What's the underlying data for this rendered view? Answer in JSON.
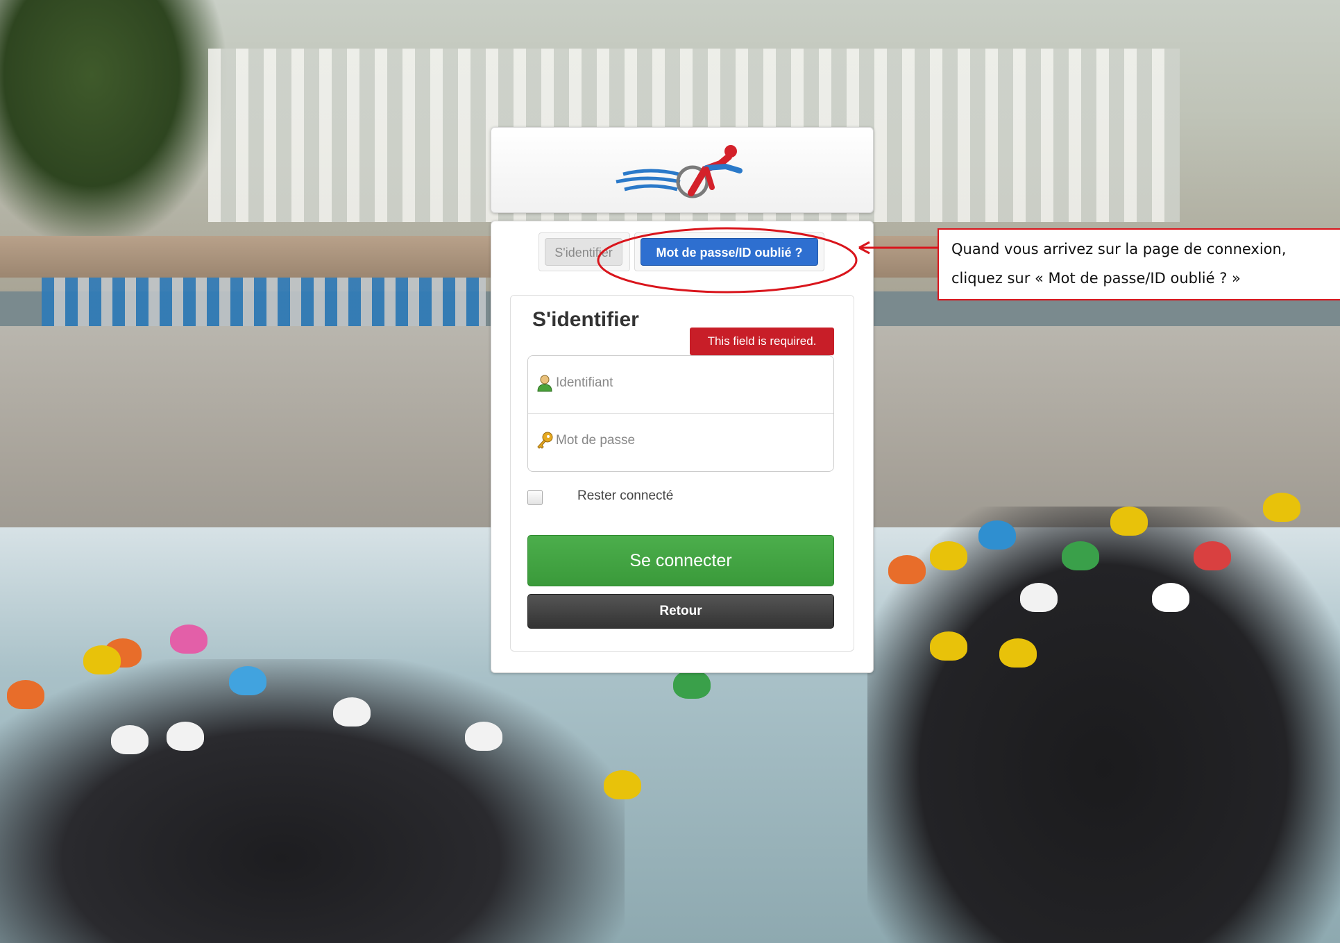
{
  "login_tabs": {
    "signin_label": "S'identifier",
    "forgot_label": "Mot de passe/ID oublié ?"
  },
  "form": {
    "title": "S'identifier",
    "validation_tooltip": "This field is required.",
    "username_placeholder": "Identifiant",
    "password_placeholder": "Mot de passe",
    "remember_label": "Rester connecté",
    "remember_checked": false,
    "submit_label": "Se connecter",
    "back_label": "Retour"
  },
  "annotation": {
    "line1": "Quand vous arrivez sur la page de connexion,",
    "line2": "cliquez sur « Mot de passe/ID oublié ? »",
    "color": "#d9151c"
  },
  "colors": {
    "forgot_button": "#2e6fd0",
    "submit_button": "#4cae4c",
    "back_button": "#444444",
    "tooltip": "#c81e28"
  },
  "icons": {
    "logo": "triathlon-logo",
    "username": "user-icon",
    "password": "key-icon"
  }
}
